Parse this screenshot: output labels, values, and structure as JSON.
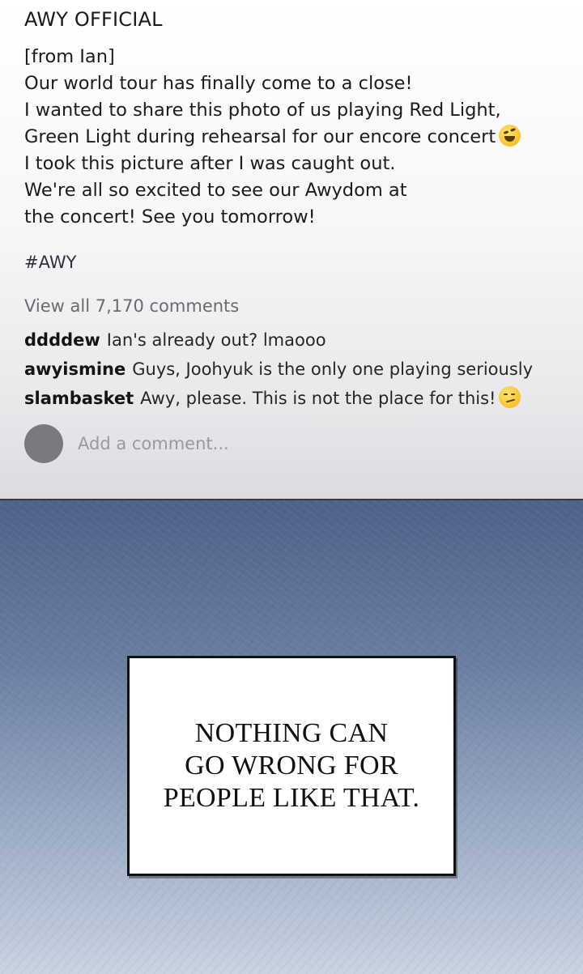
{
  "post": {
    "account_name": "AWY OFFICIAL",
    "caption_lines": [
      "[from Ian]",
      "Our world tour has finally come to a close!",
      "I wanted to share this photo of us playing Red Light,",
      "Green Light during rehearsal for our encore concert",
      "I took this picture after I was caught out.",
      "We're all so excited to see our Awydom at",
      "the concert! See you tomorrow!"
    ],
    "caption_emoji": "rolling-on-floor-laughing-emoji",
    "hashtag": "#AWY",
    "view_all_comments": "View all 7,170 comments",
    "comments": [
      {
        "user": "ddddew",
        "text": "Ian's already out? lmaooo"
      },
      {
        "user": "awyismine",
        "text": "Guys, Joohyuk is the only one playing seriously"
      },
      {
        "user": "slambasket",
        "text": "Awy, please. This is not the place for this!",
        "emoji": "smirking-face-emoji"
      }
    ],
    "add_comment_placeholder": "Add a comment..."
  },
  "narration": {
    "lines": [
      "NOTHING CAN",
      "GO WRONG FOR",
      "PEOPLE LIKE THAT."
    ]
  },
  "colors": {
    "panel_top": "#ffffff",
    "panel_bottom": "#dcdce0",
    "background_top": "#4d6289",
    "background_bottom": "#c9d3e1",
    "avatar": "#7a7a7e"
  }
}
